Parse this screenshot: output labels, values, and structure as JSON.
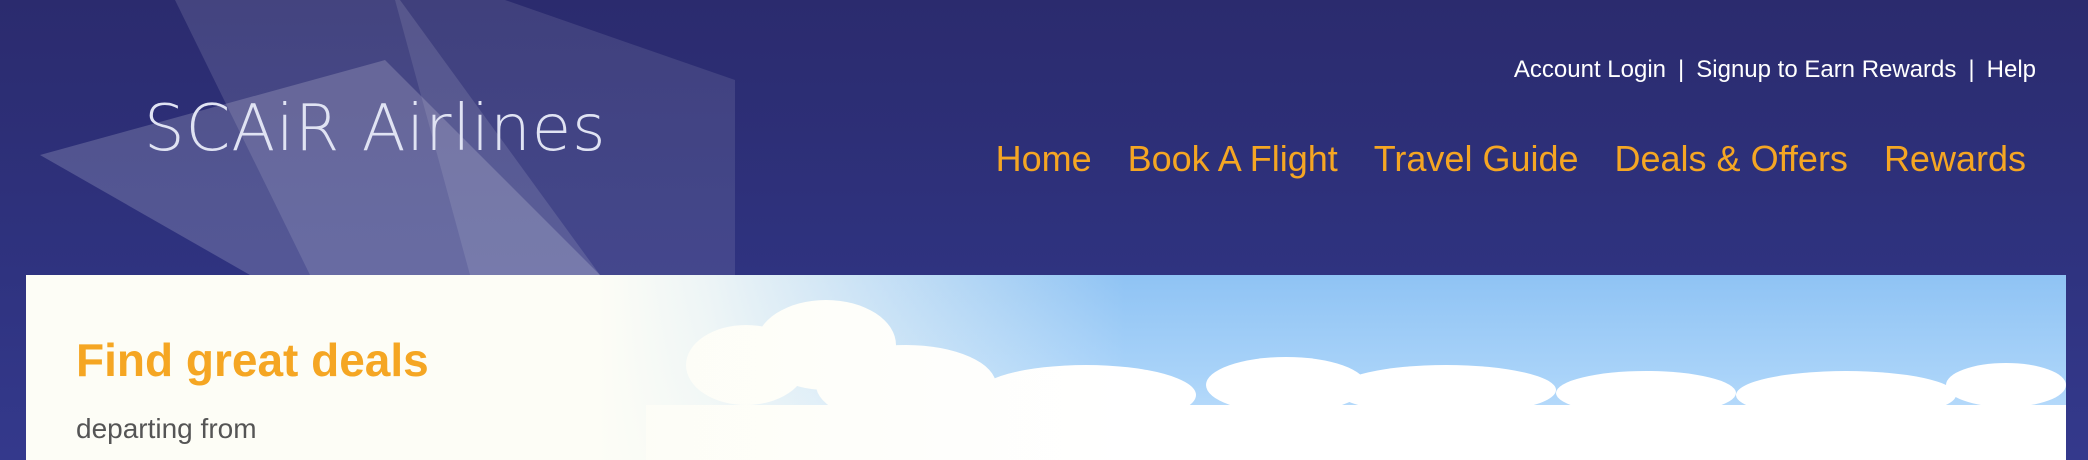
{
  "brand": {
    "name": "SCAiR Airlines"
  },
  "utility_nav": {
    "items": [
      "Account Login",
      "Signup to Earn Rewards",
      "Help"
    ],
    "separator": "|"
  },
  "main_nav": {
    "items": [
      "Home",
      "Book A Flight",
      "Travel Guide",
      "Deals & Offers",
      "Rewards"
    ]
  },
  "hero": {
    "title": "Find great deals",
    "subtitle": "departing from"
  },
  "colors": {
    "header_bg": "#2f3380",
    "accent": "#f5a623",
    "utility_text": "#ffffff",
    "sky": "#a9d3f9"
  }
}
